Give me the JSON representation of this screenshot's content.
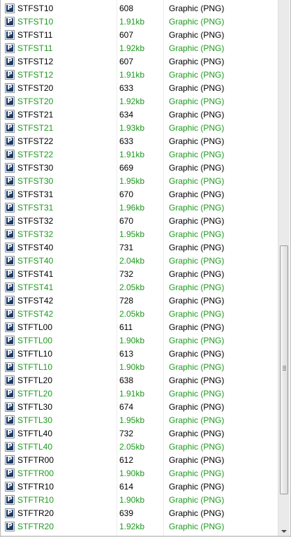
{
  "colors": {
    "text_normal": "#000000",
    "text_highlight": "#1e9a1e",
    "icon_blue": "#1b3a66"
  },
  "icon_glyph": "P",
  "rows": [
    {
      "name": "STFST10",
      "size": "608",
      "type": "Graphic (PNG)",
      "green": false
    },
    {
      "name": "STFST10",
      "size": "1.91kb",
      "type": "Graphic (PNG)",
      "green": true
    },
    {
      "name": "STFST11",
      "size": "607",
      "type": "Graphic (PNG)",
      "green": false
    },
    {
      "name": "STFST11",
      "size": "1.92kb",
      "type": "Graphic (PNG)",
      "green": true
    },
    {
      "name": "STFST12",
      "size": "607",
      "type": "Graphic (PNG)",
      "green": false
    },
    {
      "name": "STFST12",
      "size": "1.91kb",
      "type": "Graphic (PNG)",
      "green": true
    },
    {
      "name": "STFST20",
      "size": "633",
      "type": "Graphic (PNG)",
      "green": false
    },
    {
      "name": "STFST20",
      "size": "1.92kb",
      "type": "Graphic (PNG)",
      "green": true
    },
    {
      "name": "STFST21",
      "size": "634",
      "type": "Graphic (PNG)",
      "green": false
    },
    {
      "name": "STFST21",
      "size": "1.93kb",
      "type": "Graphic (PNG)",
      "green": true
    },
    {
      "name": "STFST22",
      "size": "633",
      "type": "Graphic (PNG)",
      "green": false
    },
    {
      "name": "STFST22",
      "size": "1.91kb",
      "type": "Graphic (PNG)",
      "green": true
    },
    {
      "name": "STFST30",
      "size": "669",
      "type": "Graphic (PNG)",
      "green": false
    },
    {
      "name": "STFST30",
      "size": "1.95kb",
      "type": "Graphic (PNG)",
      "green": true
    },
    {
      "name": "STFST31",
      "size": "670",
      "type": "Graphic (PNG)",
      "green": false
    },
    {
      "name": "STFST31",
      "size": "1.96kb",
      "type": "Graphic (PNG)",
      "green": true
    },
    {
      "name": "STFST32",
      "size": "670",
      "type": "Graphic (PNG)",
      "green": false
    },
    {
      "name": "STFST32",
      "size": "1.95kb",
      "type": "Graphic (PNG)",
      "green": true
    },
    {
      "name": "STFST40",
      "size": "731",
      "type": "Graphic (PNG)",
      "green": false
    },
    {
      "name": "STFST40",
      "size": "2.04kb",
      "type": "Graphic (PNG)",
      "green": true
    },
    {
      "name": "STFST41",
      "size": "732",
      "type": "Graphic (PNG)",
      "green": false
    },
    {
      "name": "STFST41",
      "size": "2.05kb",
      "type": "Graphic (PNG)",
      "green": true
    },
    {
      "name": "STFST42",
      "size": "728",
      "type": "Graphic (PNG)",
      "green": false
    },
    {
      "name": "STFST42",
      "size": "2.05kb",
      "type": "Graphic (PNG)",
      "green": true
    },
    {
      "name": "STFTL00",
      "size": "611",
      "type": "Graphic (PNG)",
      "green": false
    },
    {
      "name": "STFTL00",
      "size": "1.90kb",
      "type": "Graphic (PNG)",
      "green": true
    },
    {
      "name": "STFTL10",
      "size": "613",
      "type": "Graphic (PNG)",
      "green": false
    },
    {
      "name": "STFTL10",
      "size": "1.90kb",
      "type": "Graphic (PNG)",
      "green": true
    },
    {
      "name": "STFTL20",
      "size": "638",
      "type": "Graphic (PNG)",
      "green": false
    },
    {
      "name": "STFTL20",
      "size": "1.91kb",
      "type": "Graphic (PNG)",
      "green": true
    },
    {
      "name": "STFTL30",
      "size": "674",
      "type": "Graphic (PNG)",
      "green": false
    },
    {
      "name": "STFTL30",
      "size": "1.95kb",
      "type": "Graphic (PNG)",
      "green": true
    },
    {
      "name": "STFTL40",
      "size": "732",
      "type": "Graphic (PNG)",
      "green": false
    },
    {
      "name": "STFTL40",
      "size": "2.05kb",
      "type": "Graphic (PNG)",
      "green": true
    },
    {
      "name": "STFTR00",
      "size": "612",
      "type": "Graphic (PNG)",
      "green": false
    },
    {
      "name": "STFTR00",
      "size": "1.90kb",
      "type": "Graphic (PNG)",
      "green": true
    },
    {
      "name": "STFTR10",
      "size": "614",
      "type": "Graphic (PNG)",
      "green": false
    },
    {
      "name": "STFTR10",
      "size": "1.90kb",
      "type": "Graphic (PNG)",
      "green": true
    },
    {
      "name": "STFTR20",
      "size": "639",
      "type": "Graphic (PNG)",
      "green": false
    },
    {
      "name": "STFTR20",
      "size": "1.92kb",
      "type": "Graphic (PNG)",
      "green": true
    }
  ],
  "scrollbar": {
    "position_fraction": 0.9,
    "visible_fraction": 0.49
  }
}
